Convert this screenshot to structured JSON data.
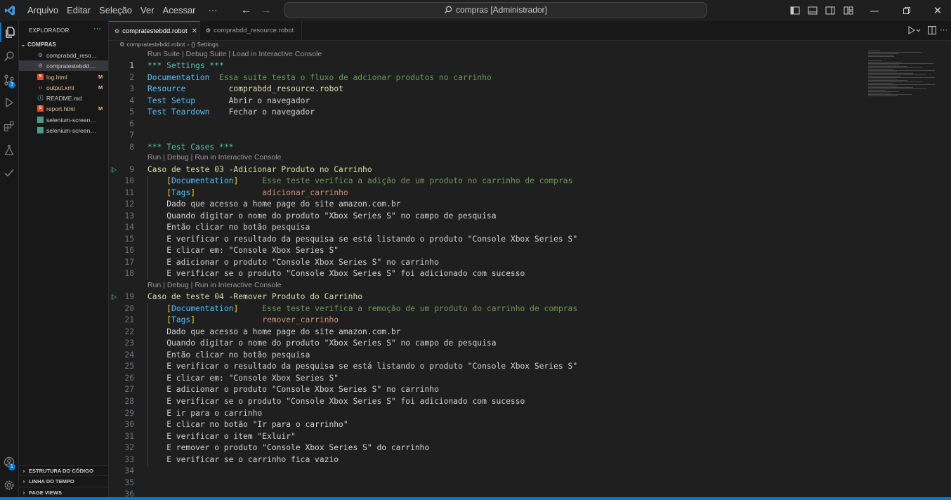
{
  "titlebar": {
    "menu": [
      "Arquivo",
      "Editar",
      "Seleção",
      "Ver",
      "Acessar",
      "···"
    ],
    "command_center": "compras [Administrador]"
  },
  "sidebar": {
    "title": "EXPLORADOR",
    "more": "···",
    "folder": "COMPRAS",
    "files": [
      {
        "name": "comprabdd_resourc...",
        "icon": "gear-file-icon",
        "status": ""
      },
      {
        "name": "compratestebdd.rob...",
        "icon": "gear-file-icon",
        "status": "",
        "selected": true
      },
      {
        "name": "log.html",
        "icon": "html-icon",
        "status": "M"
      },
      {
        "name": "output.xml",
        "icon": "xml-icon",
        "status": "M"
      },
      {
        "name": "README.md",
        "icon": "info-icon",
        "status": ""
      },
      {
        "name": "report.html",
        "icon": "html-icon",
        "status": "M"
      },
      {
        "name": "selenium-screensho...",
        "icon": "image-icon",
        "status": ""
      },
      {
        "name": "selenium-screensho...",
        "icon": "image-icon",
        "status": ""
      }
    ],
    "sections": [
      "ESTRUTURA DO CÓDIGO",
      "LINHA DO TEMPO",
      "PAGE VIEWS"
    ]
  },
  "tabs": [
    {
      "label": "compratestebdd.robot",
      "active": true
    },
    {
      "label": "comprabdd_resource.robot",
      "active": false
    }
  ],
  "breadcrumb": {
    "file": "compratestebdd.robot",
    "section": "{} Settings"
  },
  "editor": {
    "lens_settings": "Run Suite | Debug Suite | Load in Interactive Console",
    "lens_tc1": "Run | Debug | Run in Interactive Console",
    "lens_tc2": "Run | Debug | Run in Interactive Console",
    "lines": [
      {
        "n": "1",
        "t": [
          [
            "c-kw",
            "*** Settings ***"
          ]
        ]
      },
      {
        "n": "2",
        "t": [
          [
            "c-set",
            "Documentation  "
          ],
          [
            "c-com",
            "Essa suite testa o fluxo de adcionar produtos no carrinho"
          ]
        ]
      },
      {
        "n": "3",
        "t": [
          [
            "c-set",
            "Resource         "
          ],
          [
            "c-tc",
            "comprabdd_resource.robot"
          ]
        ]
      },
      {
        "n": "4",
        "t": [
          [
            "c-set",
            "Test Setup       "
          ],
          [
            "c-txt",
            "Abrir o navegador"
          ]
        ]
      },
      {
        "n": "5",
        "t": [
          [
            "c-set",
            "Test Teardown    "
          ],
          [
            "c-txt",
            "Fechar o navegador"
          ]
        ]
      },
      {
        "n": "6",
        "t": []
      },
      {
        "n": "7",
        "t": []
      },
      {
        "n": "8",
        "t": [
          [
            "c-kw",
            "*** Test Cases ***"
          ]
        ]
      },
      {
        "n": "9",
        "t": [
          [
            "c-tc",
            "Caso de teste 03 -Adicionar Produto no Carrinho"
          ]
        ]
      },
      {
        "n": "10",
        "t": [
          [
            "c-txt",
            "    "
          ],
          [
            "c-brk",
            "["
          ],
          [
            "c-tag",
            "Documentation"
          ],
          [
            "c-brk",
            "]"
          ],
          [
            "c-com",
            "     Esse teste verifica a adição de um produto no carrinho de compras"
          ]
        ]
      },
      {
        "n": "11",
        "t": [
          [
            "c-txt",
            "    "
          ],
          [
            "c-brk",
            "["
          ],
          [
            "c-tag",
            "Tags"
          ],
          [
            "c-brk",
            "]"
          ],
          [
            "c-val",
            "              adicionar_carrinho"
          ]
        ]
      },
      {
        "n": "12",
        "t": [
          [
            "c-txt",
            "    Dado que acesso a home page do site amazon.com.br"
          ]
        ]
      },
      {
        "n": "13",
        "t": [
          [
            "c-txt",
            "    Quando digitar o nome do produto \"Xbox Series S\" no campo de pesquisa"
          ]
        ]
      },
      {
        "n": "14",
        "t": [
          [
            "c-txt",
            "    Então clicar no botão pesquisa"
          ]
        ]
      },
      {
        "n": "15",
        "t": [
          [
            "c-txt",
            "    E verificar o resultado da pesquisa se está listando o produto \"Console Xbox Series S\""
          ]
        ]
      },
      {
        "n": "16",
        "t": [
          [
            "c-txt",
            "    E clicar em: \"Console Xbox Series S\""
          ]
        ]
      },
      {
        "n": "17",
        "t": [
          [
            "c-txt",
            "    E adicionar o produto \"Console Xbox Series S\" no carrinho"
          ]
        ]
      },
      {
        "n": "18",
        "t": [
          [
            "c-txt",
            "    E verificar se o produto \"Console Xbox Series S\" foi adicionado com sucesso"
          ]
        ]
      },
      {
        "n": "19",
        "t": [
          [
            "c-tc",
            "Caso de teste 04 -Remover Produto do Carrinho"
          ]
        ]
      },
      {
        "n": "20",
        "t": [
          [
            "c-txt",
            "    "
          ],
          [
            "c-brk",
            "["
          ],
          [
            "c-tag",
            "Documentation"
          ],
          [
            "c-brk",
            "]"
          ],
          [
            "c-com",
            "     Esse teste verifica a remoção de um produto do carrinho de compras"
          ]
        ]
      },
      {
        "n": "21",
        "t": [
          [
            "c-txt",
            "    "
          ],
          [
            "c-brk",
            "["
          ],
          [
            "c-tag",
            "Tags"
          ],
          [
            "c-brk",
            "]"
          ],
          [
            "c-val",
            "              remover_carrinho"
          ]
        ]
      },
      {
        "n": "22",
        "t": [
          [
            "c-txt",
            "    Dado que acesso a home page do site amazon.com.br"
          ]
        ]
      },
      {
        "n": "23",
        "t": [
          [
            "c-txt",
            "    Quando digitar o nome do produto \"Xbox Series S\" no campo de pesquisa"
          ]
        ]
      },
      {
        "n": "24",
        "t": [
          [
            "c-txt",
            "    Então clicar no botão pesquisa"
          ]
        ]
      },
      {
        "n": "25",
        "t": [
          [
            "c-txt",
            "    E verificar o resultado da pesquisa se está listando o produto \"Console Xbox Series S\""
          ]
        ]
      },
      {
        "n": "26",
        "t": [
          [
            "c-txt",
            "    E clicar em: \"Console Xbox Series S\""
          ]
        ]
      },
      {
        "n": "27",
        "t": [
          [
            "c-txt",
            "    E adicionar o produto \"Console Xbox Series S\" no carrinho"
          ]
        ]
      },
      {
        "n": "28",
        "t": [
          [
            "c-txt",
            "    E verificar se o produto \"Console Xbox Series S\" foi adicionado com sucesso"
          ]
        ]
      },
      {
        "n": "29",
        "t": [
          [
            "c-txt",
            "    E ir para o carrinho"
          ]
        ]
      },
      {
        "n": "30",
        "t": [
          [
            "c-txt",
            "    E clicar no botão \"Ir para o carrinho\""
          ]
        ]
      },
      {
        "n": "31",
        "t": [
          [
            "c-txt",
            "    E verificar o item \"Exluir\""
          ]
        ]
      },
      {
        "n": "32",
        "t": [
          [
            "c-txt",
            "    E remover o produto \"Console Xbox Series S\" do carrinho"
          ]
        ]
      },
      {
        "n": "33",
        "t": [
          [
            "c-txt",
            "    E verificar se o carrinho fica vazio"
          ]
        ]
      },
      {
        "n": "34",
        "t": []
      },
      {
        "n": "35",
        "t": []
      },
      {
        "n": "36",
        "t": []
      }
    ]
  },
  "activity_badges": {
    "source_control": "3",
    "accounts": "1"
  },
  "colors": {
    "accent": "#0078d4",
    "keyword": "#4ec9b0",
    "setting": "#4fc1ff",
    "comment": "#6a9955",
    "testcase": "#dcdcaa"
  }
}
